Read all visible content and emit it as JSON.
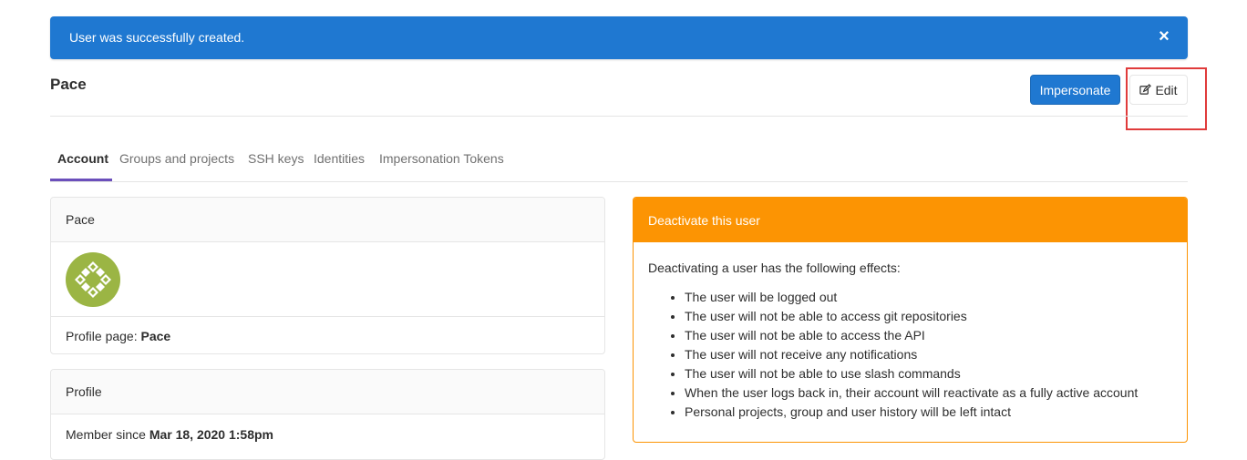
{
  "flash": {
    "message": "User was successfully created.",
    "close_icon": "close-icon",
    "close_glyph": "×"
  },
  "header": {
    "title": "Pace",
    "impersonate_label": "Impersonate",
    "edit_label": "Edit",
    "edit_icon": "pencil-square-icon"
  },
  "tabs": [
    {
      "label": "Account",
      "active": true
    },
    {
      "label": "Groups and projects",
      "active": false
    },
    {
      "label": "SSH keys",
      "active": false
    },
    {
      "label": "Identities",
      "active": false
    },
    {
      "label": "Impersonation Tokens",
      "active": false
    }
  ],
  "user_card": {
    "name": "Pace",
    "profile_page_label": "Profile page:",
    "profile_page_value": "Pace"
  },
  "profile_card": {
    "title": "Profile",
    "member_since_label": "Member since",
    "member_since_value": "Mar 18, 2020 1:58pm"
  },
  "deactivate_card": {
    "title": "Deactivate this user",
    "intro": "Deactivating a user has the following effects:",
    "effects": [
      "The user will be logged out",
      "The user will not be able to access git repositories",
      "The user will not be able to access the API",
      "The user will not receive any notifications",
      "The user will not be able to use slash commands",
      "When the user logs back in, their account will reactivate as a fully active account",
      "Personal projects, group and user history will be left intact"
    ]
  },
  "colors": {
    "primary": "#1f78d1",
    "warning": "#fc9403",
    "active_tab": "#6b4fbb",
    "highlight": "#e03b3b"
  }
}
